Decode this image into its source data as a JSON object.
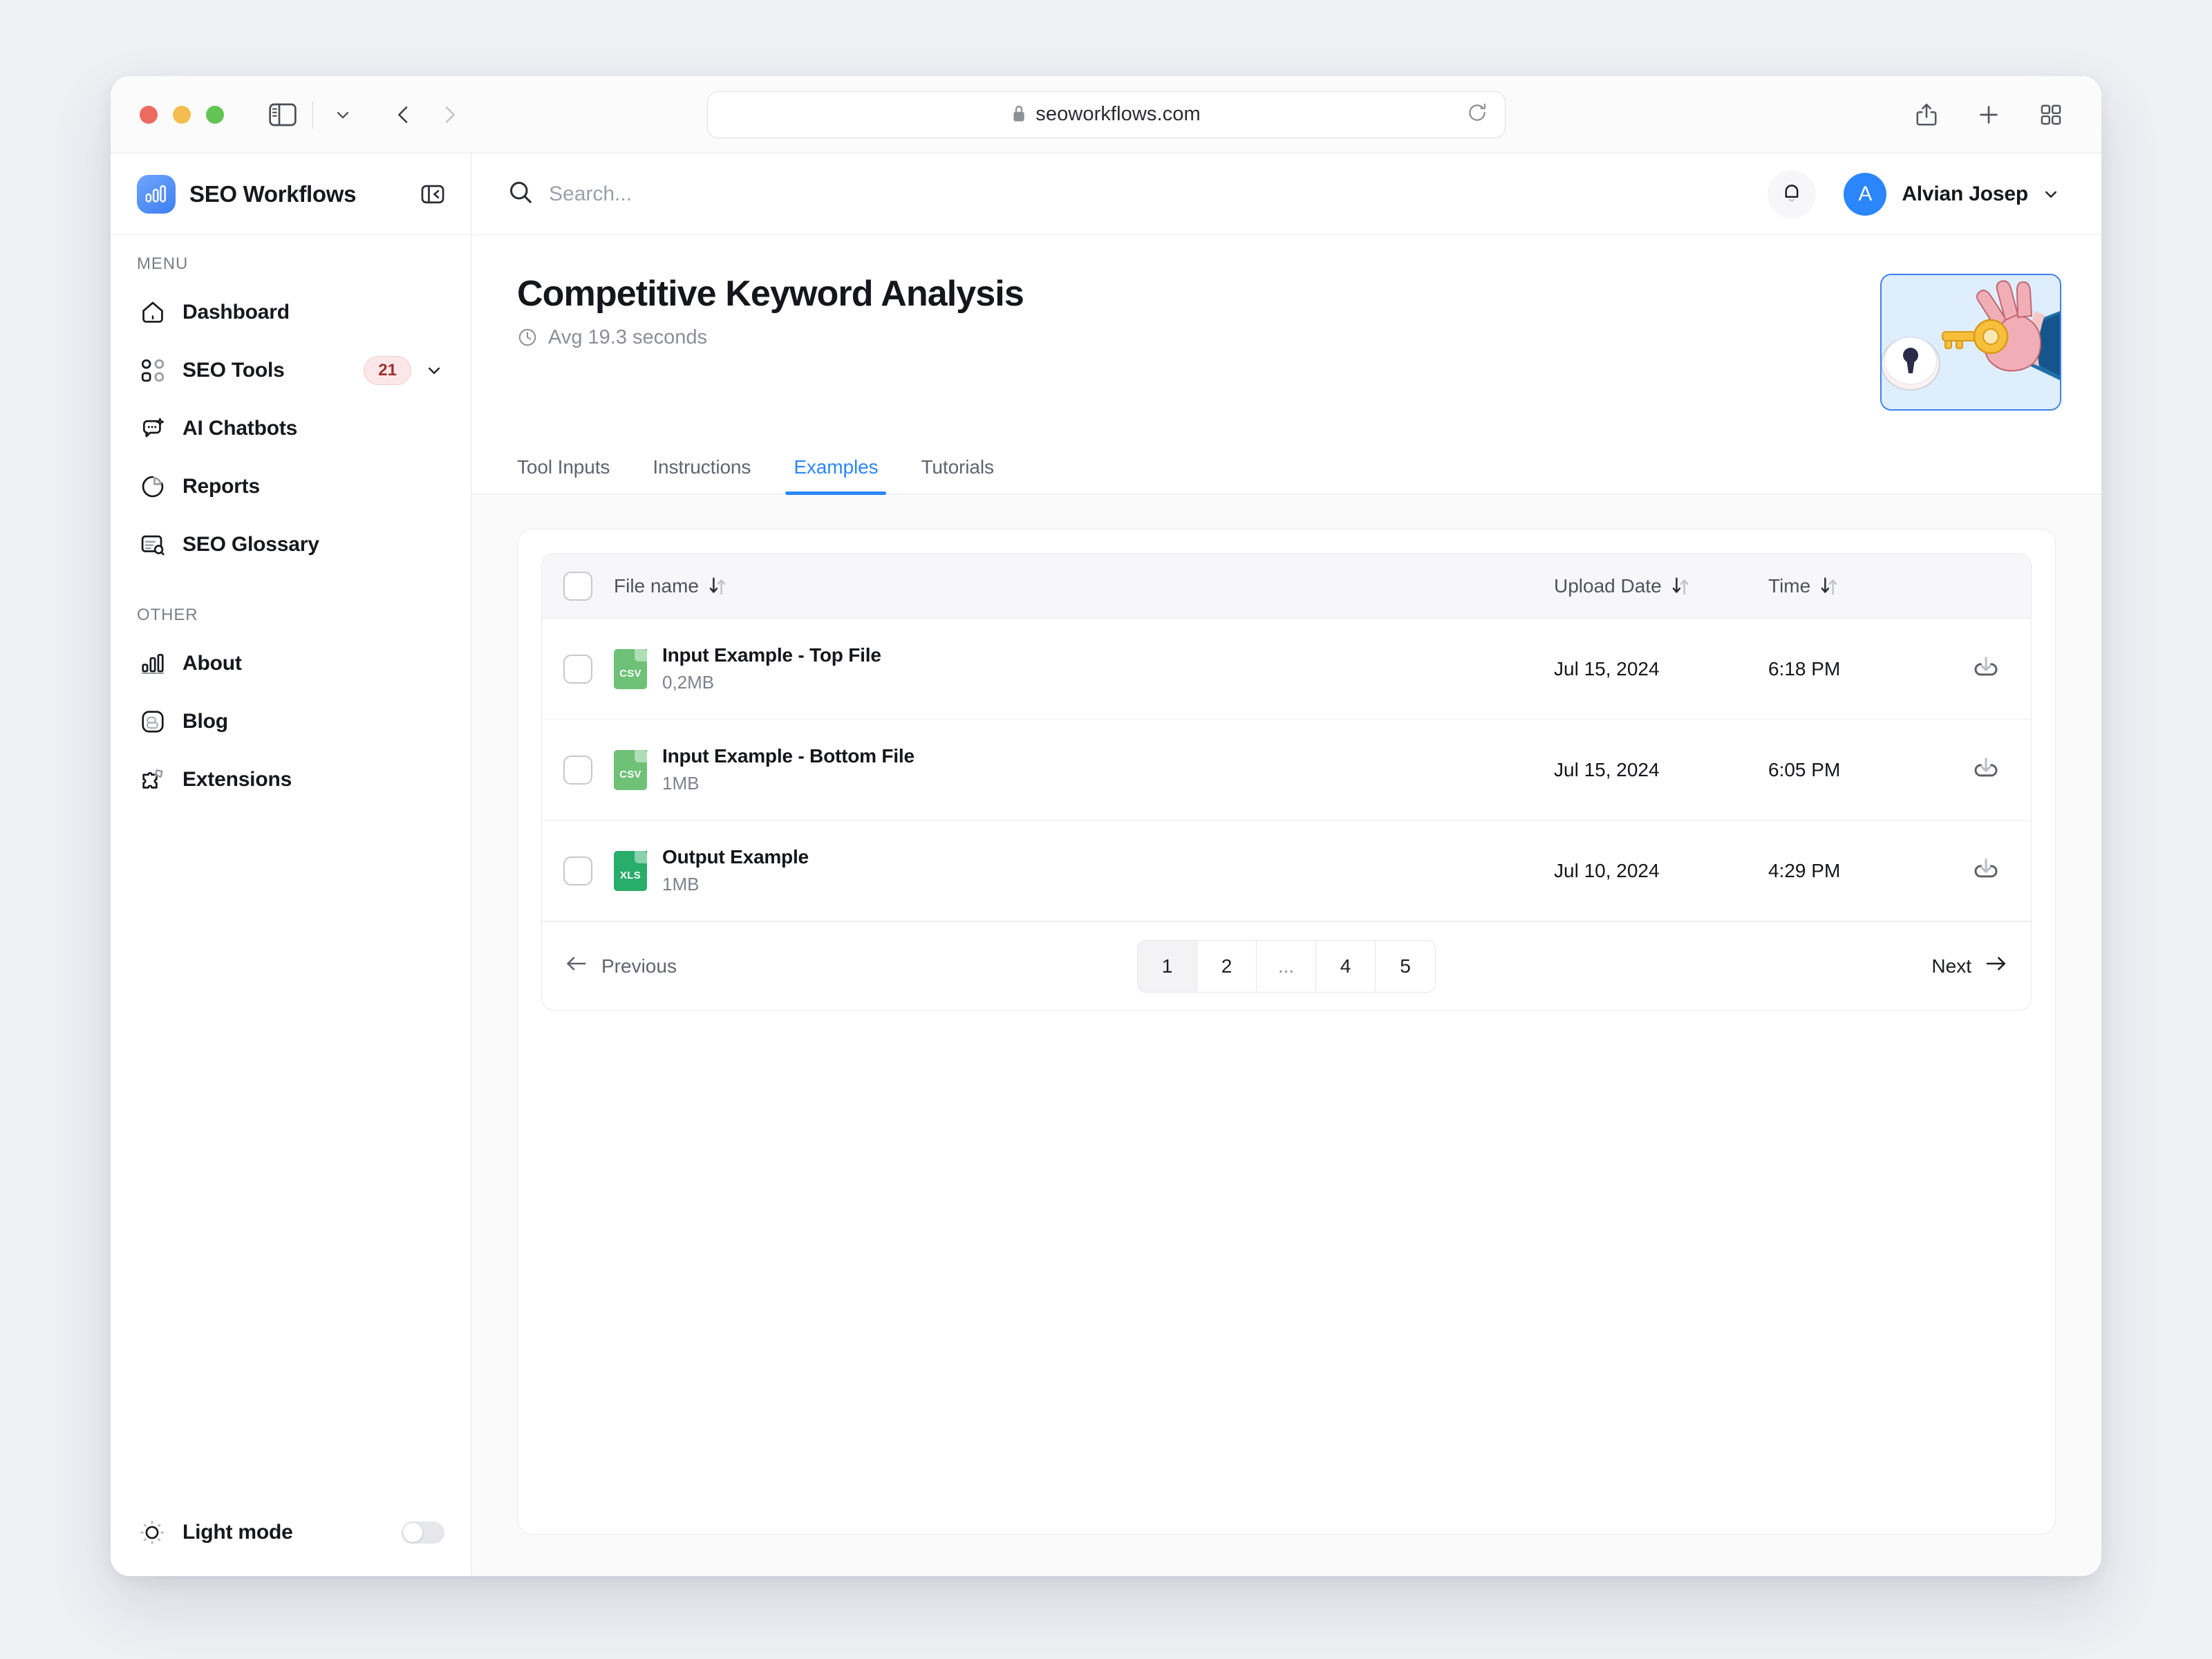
{
  "browser": {
    "url": "seoworkflows.com",
    "lock_icon": "lock-icon",
    "reload_icon": "reload-icon",
    "sidebar_toggle_icon": "sidebar-toggle-icon",
    "chevron_down_icon": "chevron-down-icon",
    "back_icon": "back-arrow-icon",
    "forward_icon": "forward-arrow-icon",
    "shield_icon": "shield-icon",
    "share_icon": "share-icon",
    "new_tab_icon": "plus-icon",
    "tab_overview_icon": "grid-icon"
  },
  "sidebar": {
    "brand": "SEO Workflows",
    "brand_logo_icon": "bar-chart-logo-icon",
    "collapse_icon": "panel-collapse-icon",
    "sections": [
      {
        "label": "MENU",
        "items": [
          {
            "label": "Dashboard",
            "icon": "home-icon"
          },
          {
            "label": "SEO Tools",
            "icon": "grid-squares-icon",
            "badge": "21",
            "chevron": "chevron-down-icon"
          },
          {
            "label": "AI Chatbots",
            "icon": "chat-sparkle-icon"
          },
          {
            "label": "Reports",
            "icon": "pie-chart-icon"
          },
          {
            "label": "SEO Glossary",
            "icon": "document-search-icon"
          }
        ]
      },
      {
        "label": "OTHER",
        "items": [
          {
            "label": "About",
            "icon": "bar-chart-icon"
          },
          {
            "label": "Blog",
            "icon": "blogger-icon"
          },
          {
            "label": "Extensions",
            "icon": "puzzle-icon"
          }
        ]
      }
    ],
    "footer": {
      "label": "Light mode",
      "icon": "sun-icon",
      "toggle_on": false
    }
  },
  "topbar": {
    "search_placeholder": "Search...",
    "search_value": "",
    "search_icon": "search-icon",
    "bell_icon": "bell-icon",
    "user": {
      "initial": "A",
      "name": "Alvian Josep",
      "chevron": "chevron-down-icon"
    }
  },
  "page": {
    "title": "Competitive Keyword Analysis",
    "subtitle": "Avg 19.3 seconds",
    "subtitle_icon": "clock-icon",
    "hero_icon": "hand-key-lock-illustration"
  },
  "tabs": [
    {
      "label": "Tool Inputs",
      "active": false
    },
    {
      "label": "Instructions",
      "active": false
    },
    {
      "label": "Examples",
      "active": true
    },
    {
      "label": "Tutorials",
      "active": false
    }
  ],
  "table": {
    "columns": {
      "file_name": "File name",
      "upload_date": "Upload Date",
      "time": "Time"
    },
    "sort_icon": "sort-arrows-icon",
    "download_icon": "download-icon",
    "rows": [
      {
        "name": "Input Example - Top File",
        "size": "0,2MB",
        "ext": "CSV",
        "ext_color": "#6ec177",
        "date": "Jul 15, 2024",
        "time": "6:18 PM"
      },
      {
        "name": "Input Example - Bottom File",
        "size": "1MB",
        "ext": "CSV",
        "ext_color": "#6ec177",
        "date": "Jul 15, 2024",
        "time": "6:05 PM"
      },
      {
        "name": "Output Example",
        "size": "1MB",
        "ext": "XLS",
        "ext_color": "#29ad6b",
        "date": "Jul 10, 2024",
        "time": "4:29 PM"
      }
    ]
  },
  "pagination": {
    "previous": "Previous",
    "next": "Next",
    "prev_icon": "arrow-left-icon",
    "next_icon": "arrow-right-icon",
    "pages": [
      {
        "label": "1",
        "active": true
      },
      {
        "label": "2",
        "active": false
      },
      {
        "label": "...",
        "active": false,
        "ellipsis": true
      },
      {
        "label": "4",
        "active": false
      },
      {
        "label": "5",
        "active": false
      }
    ]
  },
  "colors": {
    "accent": "#2b86fb",
    "page_bg": "#eef0f4",
    "badge_bg": "#fbe7e7",
    "badge_text": "#9d3030",
    "csv_green": "#6ec177",
    "xls_green": "#29ad6b"
  }
}
